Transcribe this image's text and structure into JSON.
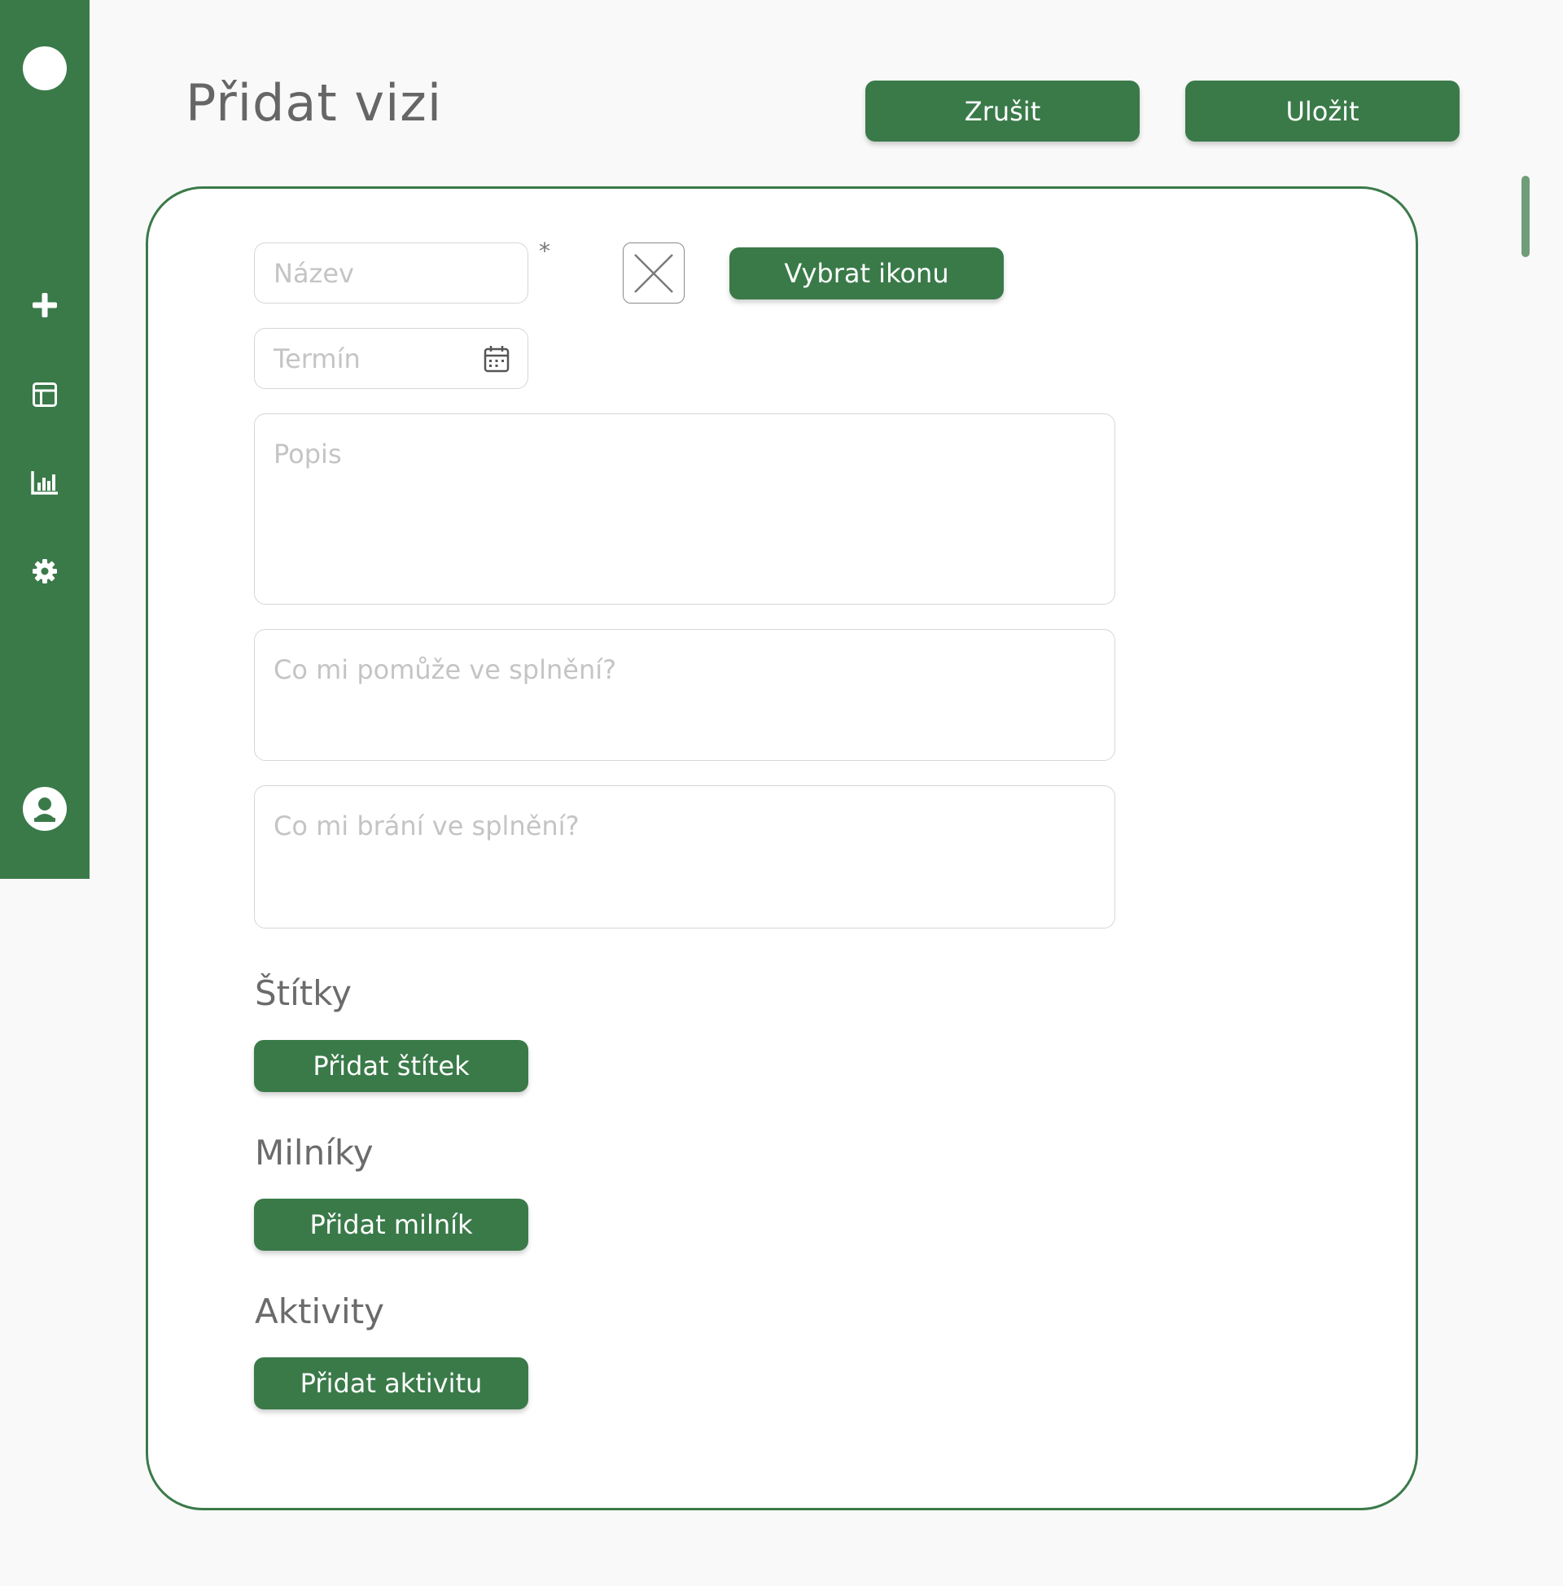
{
  "header": {
    "title": "Přidat vizi",
    "cancel_label": "Zrušit",
    "save_label": "Uložit"
  },
  "sidebar": {
    "items": [
      {
        "icon": "logo-circle"
      },
      {
        "icon": "plus-icon"
      },
      {
        "icon": "layout-icon"
      },
      {
        "icon": "bar-chart-icon"
      },
      {
        "icon": "gear-icon"
      },
      {
        "icon": "user-icon"
      }
    ]
  },
  "form": {
    "name_placeholder": "Název",
    "required_mark": "*",
    "choose_icon_label": "Vybrat ikonu",
    "deadline_placeholder": "Termín",
    "description_placeholder": "Popis",
    "helps_placeholder": "Co mi pomůže ve splnění?",
    "blocks_placeholder": "Co mi brání ve splnění?"
  },
  "sections": {
    "tags": {
      "title": "Štítky",
      "button": "Přidat štítek"
    },
    "milestones": {
      "title": "Milníky",
      "button": "Přidat milník"
    },
    "activities": {
      "title": "Aktivity",
      "button": "Přidat aktivitu"
    }
  },
  "colors": {
    "accent": "#3a7a49",
    "background": "#f9f9f9",
    "placeholder": "#c4c4c4",
    "heading": "#666666"
  }
}
